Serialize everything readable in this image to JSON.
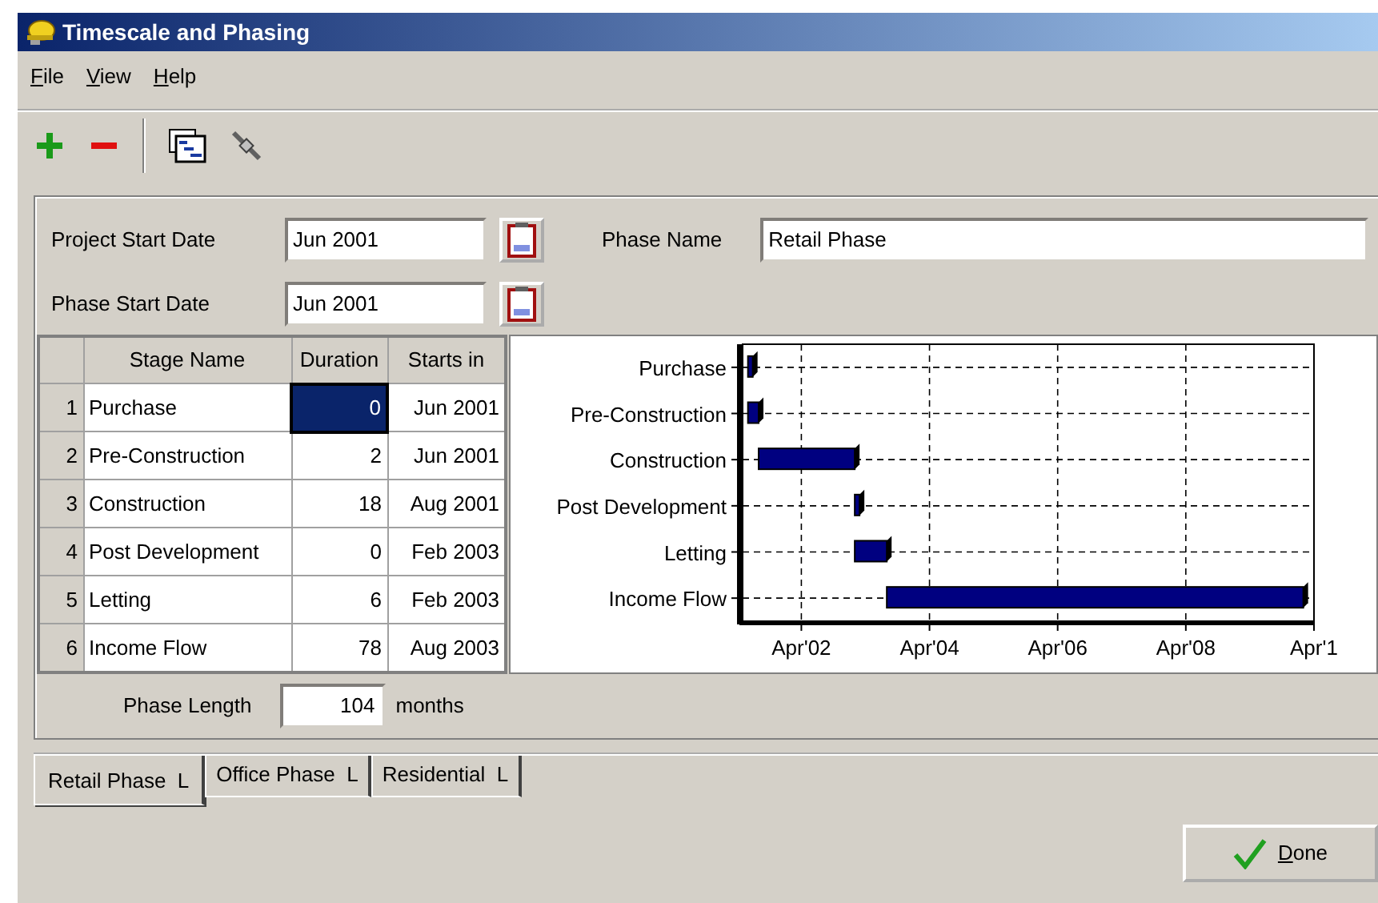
{
  "window": {
    "title": "Timescale and Phasing"
  },
  "menu": [
    {
      "label": "File"
    },
    {
      "label": "View"
    },
    {
      "label": "Help"
    }
  ],
  "project_start": {
    "label": "Project Start Date",
    "value": "Jun 2001"
  },
  "phase_start": {
    "label": "Phase Start Date",
    "value": "Jun 2001"
  },
  "phase_name": {
    "label": "Phase Name",
    "value": "Retail Phase"
  },
  "table": {
    "columns": [
      "Stage Name",
      "Duration",
      "Starts in"
    ],
    "rows": [
      {
        "number": "1",
        "stage": "Purchase",
        "duration": "0",
        "starts": "Jun 2001",
        "duration_selected": true
      },
      {
        "number": "2",
        "stage": "Pre-Construction",
        "duration": "2",
        "starts": "Jun 2001",
        "duration_selected": false
      },
      {
        "number": "3",
        "stage": "Construction",
        "duration": "18",
        "starts": "Aug 2001",
        "duration_selected": false
      },
      {
        "number": "4",
        "stage": "Post Development",
        "duration": "0",
        "starts": "Feb 2003",
        "duration_selected": false
      },
      {
        "number": "5",
        "stage": "Letting",
        "duration": "6",
        "starts": "Feb 2003",
        "duration_selected": false
      },
      {
        "number": "6",
        "stage": "Income Flow",
        "duration": "78",
        "starts": "Aug 2003",
        "duration_selected": false
      }
    ]
  },
  "chart": {
    "stage_labels": [
      "Purchase",
      "Pre-Construction",
      "Construction",
      "Post Development",
      "Letting",
      "Income Flow"
    ],
    "axis_labels": [
      "Apr'02",
      "Apr'04",
      "Apr'06",
      "Apr'08",
      "Apr'1"
    ]
  },
  "phase_length": {
    "label": "Phase Length",
    "value": "104",
    "unit": "months"
  },
  "tabs": [
    {
      "label": "Retail Phase",
      "marker": "L",
      "selected": true
    },
    {
      "label": "Office Phase",
      "marker": "L",
      "selected": false
    },
    {
      "label": "Residential",
      "marker": "L",
      "selected": false
    }
  ],
  "done_button": {
    "label": "Done"
  }
}
